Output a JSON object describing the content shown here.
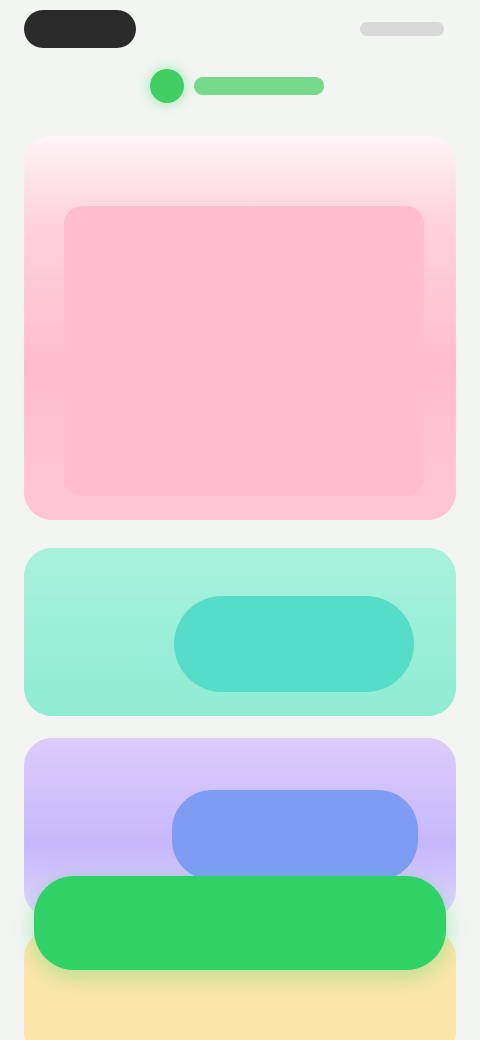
{
  "app": {
    "name": "",
    "brand_color": "#3fcf63"
  },
  "status_bar": {
    "time": "",
    "icons": [
      "signal-icon",
      "wifi-icon",
      "battery-icon"
    ]
  },
  "cards": [
    {
      "title": "",
      "color": "#ffbcd0"
    },
    {
      "title": "",
      "color": "#8eecd2"
    },
    {
      "title": "",
      "color": "#c6b7fb"
    },
    {
      "title": "",
      "color": "#fbe6a8"
    }
  ],
  "cta": {
    "label": "",
    "color": "#2fd264"
  }
}
